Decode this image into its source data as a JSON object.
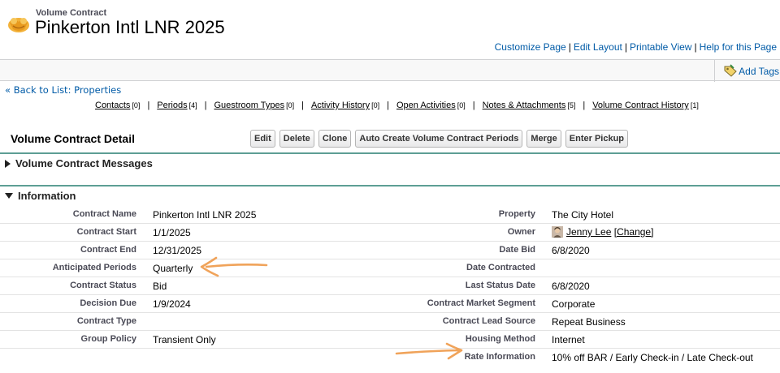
{
  "header": {
    "object_type": "Volume Contract",
    "record_name": "Pinkerton Intl LNR 2025",
    "icon": "handshake-icon"
  },
  "top_links": [
    "Customize Page",
    "Edit Layout",
    "Printable View",
    "Help for this Page"
  ],
  "tag_bar": {
    "add_tags_label": "Add Tags",
    "icon": "tag-icon"
  },
  "back_link": "« Back to List: Properties",
  "related_links": [
    {
      "label": "Contacts",
      "count": "[0]"
    },
    {
      "label": "Periods",
      "count": "[4]"
    },
    {
      "label": "Guestroom Types",
      "count": "[0]"
    },
    {
      "label": "Activity History",
      "count": "[0]"
    },
    {
      "label": "Open Activities",
      "count": "[0]"
    },
    {
      "label": "Notes & Attachments",
      "count": "[5]"
    },
    {
      "label": "Volume Contract History",
      "count": "[1]"
    }
  ],
  "detail": {
    "title": "Volume Contract Detail",
    "buttons": [
      "Edit",
      "Delete",
      "Clone",
      "Auto Create Volume Contract Periods",
      "Merge",
      "Enter Pickup"
    ]
  },
  "sections": {
    "messages": "Volume Contract Messages",
    "information": "Information"
  },
  "fields": [
    {
      "left_label": "Contract Name",
      "left_value": "Pinkerton Intl LNR 2025",
      "right_label": "Property",
      "right_value": "The City Hotel"
    },
    {
      "left_label": "Contract Start",
      "left_value": "1/1/2025",
      "right_label": "Owner",
      "right_value": ""
    },
    {
      "left_label": "Contract End",
      "left_value": "12/31/2025",
      "right_label": "Date Bid",
      "right_value": "6/8/2020"
    },
    {
      "left_label": "Anticipated Periods",
      "left_value": "Quarterly",
      "right_label": "Date Contracted",
      "right_value": ""
    },
    {
      "left_label": "Contract Status",
      "left_value": "Bid",
      "right_label": "Last Status Date",
      "right_value": "6/8/2020"
    },
    {
      "left_label": "Decision Due",
      "left_value": "1/9/2024",
      "right_label": "Contract Market Segment",
      "right_value": "Corporate"
    },
    {
      "left_label": "Contract Type",
      "left_value": "",
      "right_label": "Contract Lead Source",
      "right_value": "Repeat Business"
    },
    {
      "left_label": "Group Policy",
      "left_value": "Transient Only",
      "right_label": "Housing Method",
      "right_value": "Internet"
    },
    {
      "left_label": "",
      "left_value": "",
      "right_label": "Rate Information",
      "right_value": "10% off BAR / Early Check-in / Late Check-out"
    }
  ],
  "owner": {
    "name": "Jenny Lee",
    "change_label": "[Change]",
    "icon": "user-avatar-icon"
  },
  "annotations": {
    "color": "#f0a35a"
  }
}
